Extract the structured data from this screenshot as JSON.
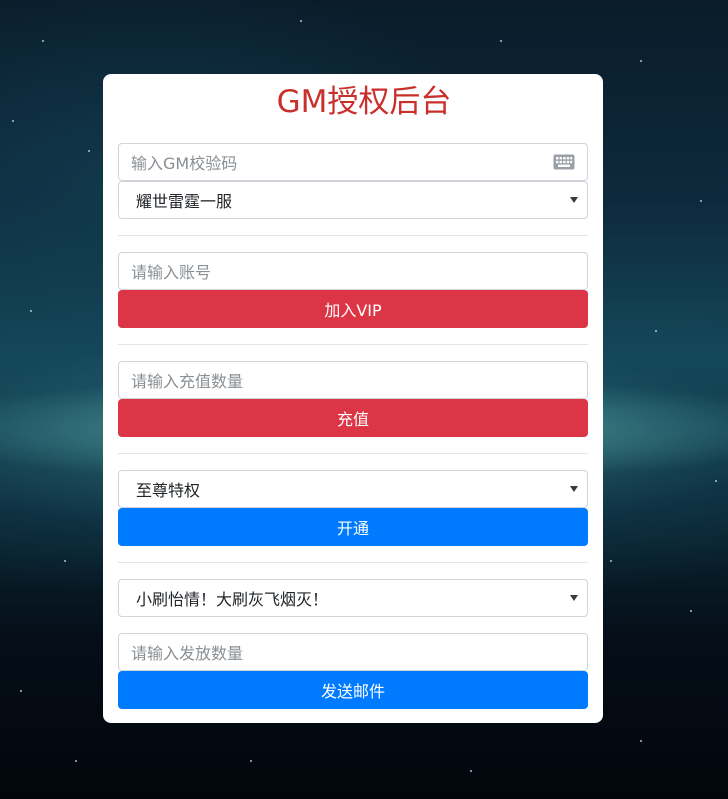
{
  "title": "GM授权后台",
  "gm_code": {
    "placeholder": "输入GM校验码",
    "icon": "keyboard-icon"
  },
  "server_select": {
    "selected": "耀世雷霆一服"
  },
  "vip_section": {
    "account_placeholder": "请输入账号",
    "button_label": "加入VIP"
  },
  "recharge_section": {
    "amount_placeholder": "请输入充值数量",
    "button_label": "充值"
  },
  "privilege_section": {
    "selected": "至尊特权",
    "button_label": "开通"
  },
  "mail_section": {
    "selected": "小刷怡情！大刷灰飞烟灭！",
    "quantity_placeholder": "请输入发放数量",
    "button_label": "发送邮件"
  },
  "colors": {
    "title": "#c9302c",
    "danger_button": "#dc3545",
    "primary_button": "#007bff"
  }
}
